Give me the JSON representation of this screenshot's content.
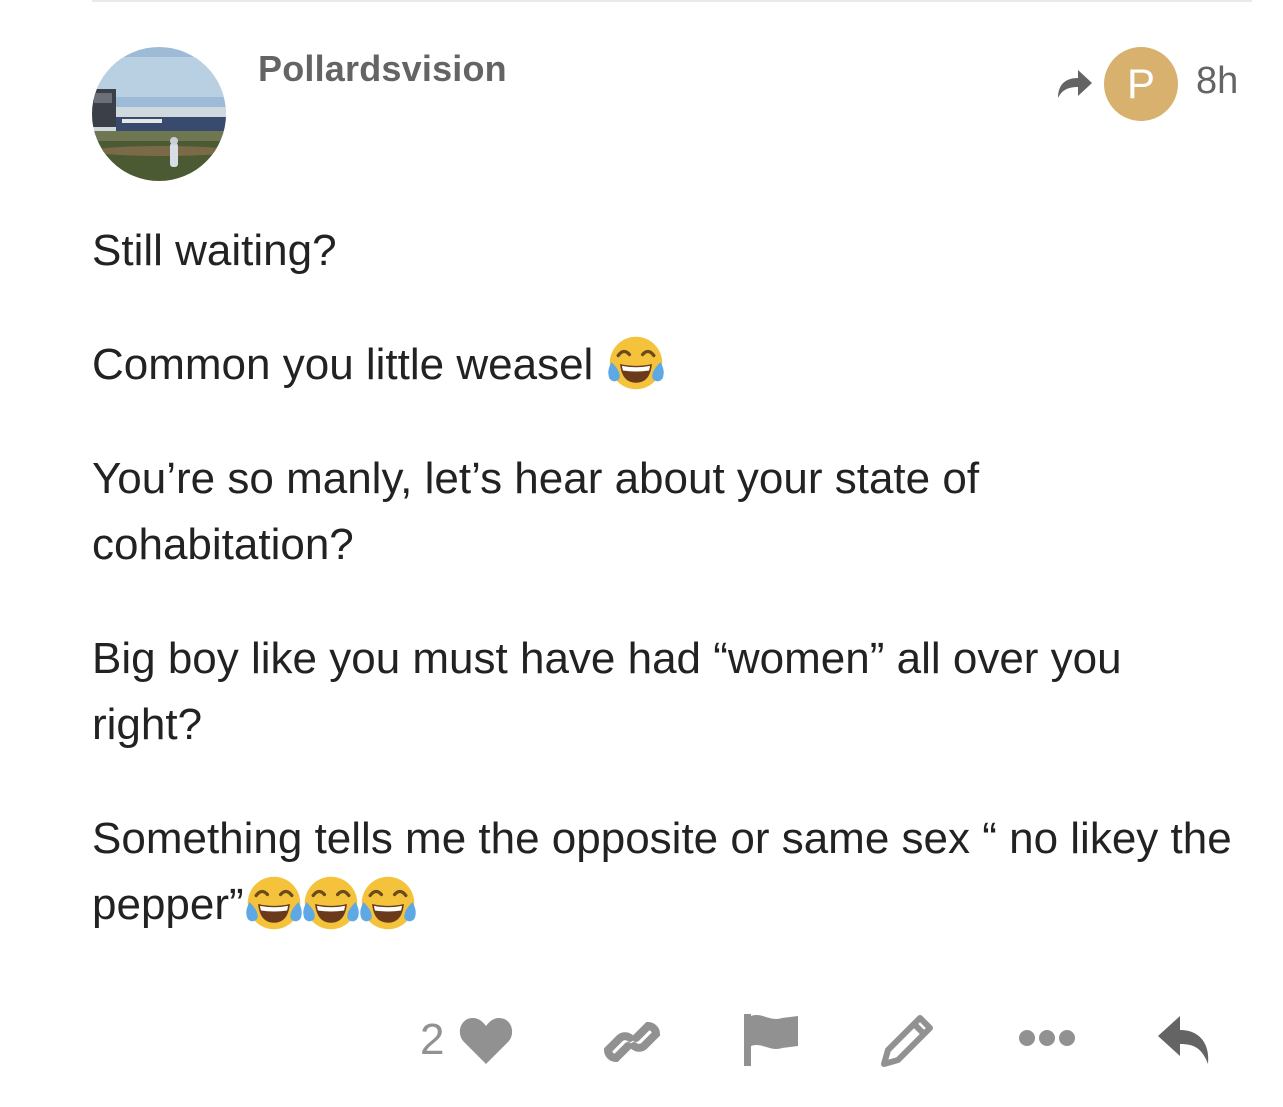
{
  "post": {
    "username": "Pollardsvision",
    "reply_to_avatar_letter": "P",
    "age": "8h",
    "paragraphs": [
      {
        "text": "Still waiting?",
        "emoji_count": 0
      },
      {
        "text": "Common you little weasel",
        "emoji_count": 1
      },
      {
        "text": "You’re so manly, let’s hear about your state of cohabitation?",
        "emoji_count": 0
      },
      {
        "text": "Big boy like you must have had “women” all over you right?",
        "emoji_count": 0
      },
      {
        "text": "Something tells me the opposite or same sex “ no likey the pepper”",
        "emoji_count": 3
      }
    ],
    "emoji_name": "face-with-tears-of-joy",
    "like_count": "2"
  },
  "icons": {
    "reply_to": "share-arrow-icon",
    "like": "heart-icon",
    "link": "link-icon",
    "flag": "flag-icon",
    "edit": "pencil-icon",
    "more": "ellipsis-icon",
    "reply": "reply-icon"
  },
  "colors": {
    "text": "#222222",
    "muted": "#646464",
    "icon": "#919191",
    "avatar_letter_bg": "#d8b16e",
    "divider": "#e9e9e9"
  }
}
